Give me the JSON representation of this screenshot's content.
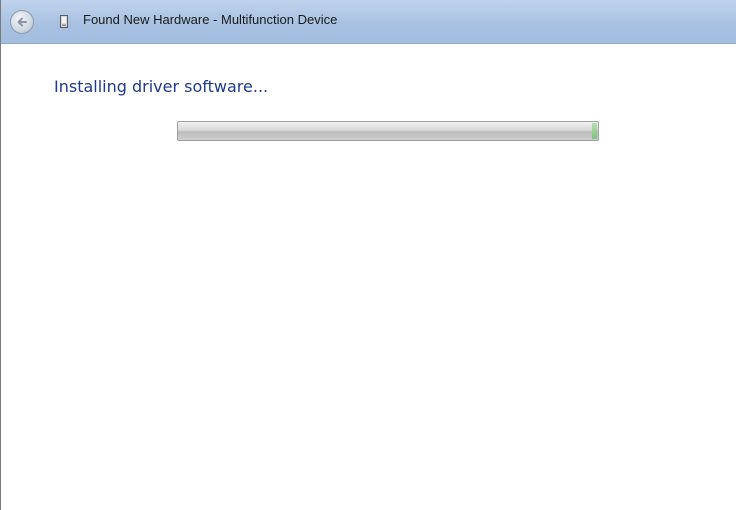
{
  "window": {
    "title": "Found New Hardware - Multifunction Device"
  },
  "icons": {
    "back": "back-arrow-icon",
    "device": "usb-device-icon"
  },
  "main": {
    "heading": "Installing driver software...",
    "progress": {
      "value": 1.0,
      "indeterminate": true
    }
  },
  "colors": {
    "titlebar": "#a9c2e2",
    "heading": "#1e3a8a",
    "progress_tip": "#7fc27a"
  }
}
